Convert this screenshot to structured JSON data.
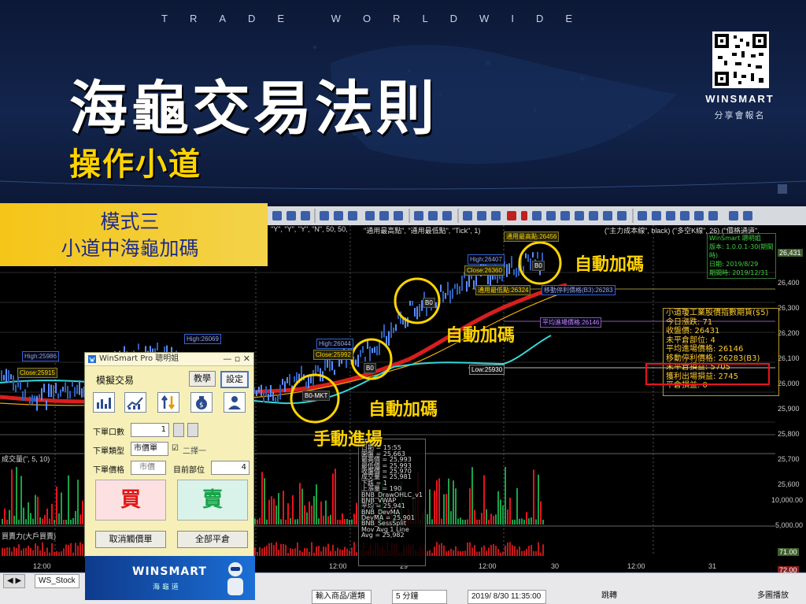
{
  "banner": {
    "tagline": "TRADE WORLDWIDE",
    "title": "海龜交易法則",
    "subtitle": "操作小道",
    "brand": "WINSMART",
    "brand_sub": "分享會報名"
  },
  "mode": {
    "line1": "模式三",
    "line2": "小道中海龜加碼"
  },
  "indicator_bar": "(\"主力成本線\", black) (\"多空K線\", 26) (\"價格通道\",",
  "chart_top_labels": [
    "\"Y\", \"Y\", \"Y\", \"N\", 50, 50,",
    "\"通用最高點\", \"通用最低點\", \"Tick\", 1)"
  ],
  "price_labels": [
    {
      "text": "High:25986",
      "kind": "high"
    },
    {
      "text": "Close:25915",
      "kind": "close"
    },
    {
      "text": "High:26069",
      "kind": "high"
    },
    {
      "text": "High:26044",
      "kind": "high"
    },
    {
      "text": "Close:25992",
      "kind": "close"
    },
    {
      "text": "High:26407",
      "kind": "high"
    },
    {
      "text": "Close:26360",
      "kind": "close"
    },
    {
      "text": "通用最高點:26456",
      "kind": "close"
    },
    {
      "text": "通用最低點:26324",
      "kind": "close"
    },
    {
      "text": "移動停利價格(B3):26283",
      "kind": "line"
    },
    {
      "text": "平均進場價格:26146",
      "kind": "line"
    },
    {
      "text": "Low:25930",
      "kind": "low"
    }
  ],
  "y_axis": [
    "26,431",
    "26,400",
    "26,300",
    "26,200",
    "26,100",
    "26,000",
    "25,900",
    "25,800",
    "25,700",
    "25,600"
  ],
  "vol_axis": [
    "10,000.00",
    "5,000.00",
    "71.00",
    "72.00"
  ],
  "x_axis": [
    "12:00",
    "12:00",
    "29",
    "12:00",
    "30",
    "12:00",
    "31"
  ],
  "sub_labels": [
    "成交量(\", 5, 10)",
    "買賣力(大戶買賣)"
  ],
  "annotations": {
    "manual": "手動進場",
    "auto1": "自動加碼",
    "auto2": "自動加碼",
    "auto3": "自動加碼"
  },
  "markers": [
    "B0-MKT",
    "B0",
    "B0",
    "B0"
  ],
  "strategy_info": {
    "header": "WinSmart 聰明姐",
    "version": "版本: 1.0.0.1-30(期間時)",
    "date1": "日期: 2019/8/29",
    "date2": "期間時: 2019/12/31"
  },
  "info_panel": [
    "小道瓊工業股價指數期貨($5)",
    "今日漲跌: 71",
    "收盤價: 26431",
    "未平倉部位: 4",
    "平均進場價格: 26146",
    "移動停利價格: 26283(B3)",
    "未平倉損益: 5705",
    "獲利出場損益: 2745",
    "平倉損益: 0"
  ],
  "stat_box": [
    "時間:",
    "日期 = 15:55",
    "開盤 = 25,663",
    "最高價 = 25,993",
    "最低價 = 25,993",
    "收盤價 = 25,970",
    "成交量 = 25,981",
    "下跌 = 1",
    "上漲量 = 190",
    "BNB_DrawOHLC_v1",
    "BNB_VWAP",
    "平均 = 25,941",
    "BNB_DevMA",
    "DevMA = 25,901",
    "BNB_SessSplit",
    "Mov Avg 1 Line",
    "Avg = 25,982"
  ],
  "dialog": {
    "title": "WinSmart Pro 聰明姐",
    "section": "模擬交易",
    "btn_teach": "教學",
    "btn_settings": "設定",
    "qty_label": "下單口數",
    "qty_value": "1",
    "type_label": "下單類型",
    "type_value": "市價單",
    "oco_label": "二擇一",
    "price_label": "下單價格",
    "price_value": "市價",
    "position_label": "目前部位",
    "position_value": "4",
    "buy": "買",
    "sell": "賣",
    "cancel": "取消觸價單",
    "close_all": "全部平倉",
    "logo": "WINSMART",
    "logo_sub": "海 龜 道"
  },
  "bottom": {
    "tab": "WS_Stock",
    "product_input": "輸入商品/選類",
    "interval": "5 分鐘",
    "datetime": "2019/ 8/30 11:35:00",
    "jump": "跳轉",
    "multi": "多圖播放"
  },
  "colors": {
    "up": "#e8141c",
    "down": "#19a34a",
    "accent": "#ffd400",
    "ma_red": "#d81e1e",
    "ma_cyan": "#36d6d6"
  }
}
